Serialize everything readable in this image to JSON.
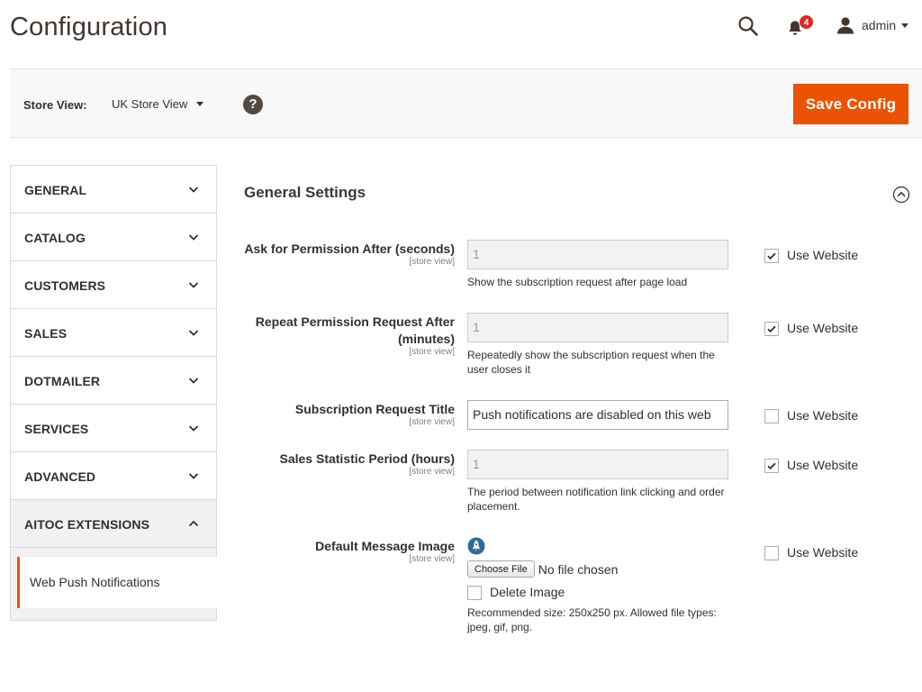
{
  "header": {
    "title": "Configuration",
    "notification_count": "4",
    "user_name": "admin"
  },
  "toolbar": {
    "store_label": "Store View:",
    "store_value": "UK Store View",
    "help_glyph": "?",
    "save_label": "Save Config"
  },
  "sidebar": {
    "items": [
      {
        "label": "GENERAL",
        "expanded": false
      },
      {
        "label": "CATALOG",
        "expanded": false
      },
      {
        "label": "CUSTOMERS",
        "expanded": false
      },
      {
        "label": "SALES",
        "expanded": false
      },
      {
        "label": "DOTMAILER",
        "expanded": false
      },
      {
        "label": "SERVICES",
        "expanded": false
      },
      {
        "label": "ADVANCED",
        "expanded": false
      },
      {
        "label": "AITOC EXTENSIONS",
        "expanded": true
      }
    ],
    "sub_items": [
      {
        "label": "Web Push Notifications",
        "active": true
      }
    ]
  },
  "section": {
    "title": "General Settings"
  },
  "fields": {
    "ask_permission": {
      "label": "Ask for Permission After (seconds)",
      "scope": "[store view]",
      "value": "1",
      "note": "Show the subscription request after page load",
      "use_website_label": "Use Website",
      "use_website_checked": true
    },
    "repeat_request": {
      "label": "Repeat Permission Request After (minutes)",
      "scope": "[store view]",
      "value": "1",
      "note": "Repeatedly show the subscription request when the user closes it",
      "use_website_label": "Use Website",
      "use_website_checked": true
    },
    "request_title": {
      "label": "Subscription Request Title",
      "scope": "[store view]",
      "value": "Push notifications are disabled on this web",
      "use_website_label": "Use Website",
      "use_website_checked": false
    },
    "sales_period": {
      "label": "Sales Statistic Period (hours)",
      "scope": "[store view]",
      "value": "1",
      "note": "The period between notification link clicking and order placement.",
      "use_website_label": "Use Website",
      "use_website_checked": true
    },
    "default_image": {
      "label": "Default Message Image",
      "scope": "[store view]",
      "choose_file_label": "Choose File",
      "file_status": "No file chosen",
      "delete_label": "Delete Image",
      "delete_checked": false,
      "note": "Recommended size: 250x250 px. Allowed file types: jpeg, gif, png.",
      "use_website_label": "Use Website",
      "use_website_checked": false
    }
  },
  "colors": {
    "accent": "#eb5202",
    "badge": "#e22626",
    "text_dark": "#41362f"
  },
  "icons": {
    "search": "search-icon",
    "notifications": "bell-icon",
    "user": "user-icon",
    "help": "help-icon",
    "collapse": "chevron-up-circle-icon",
    "chevron_down": "chevron-down-icon",
    "chevron_up": "chevron-up-icon",
    "check": "check-icon",
    "image_preview": "rocket-icon"
  }
}
